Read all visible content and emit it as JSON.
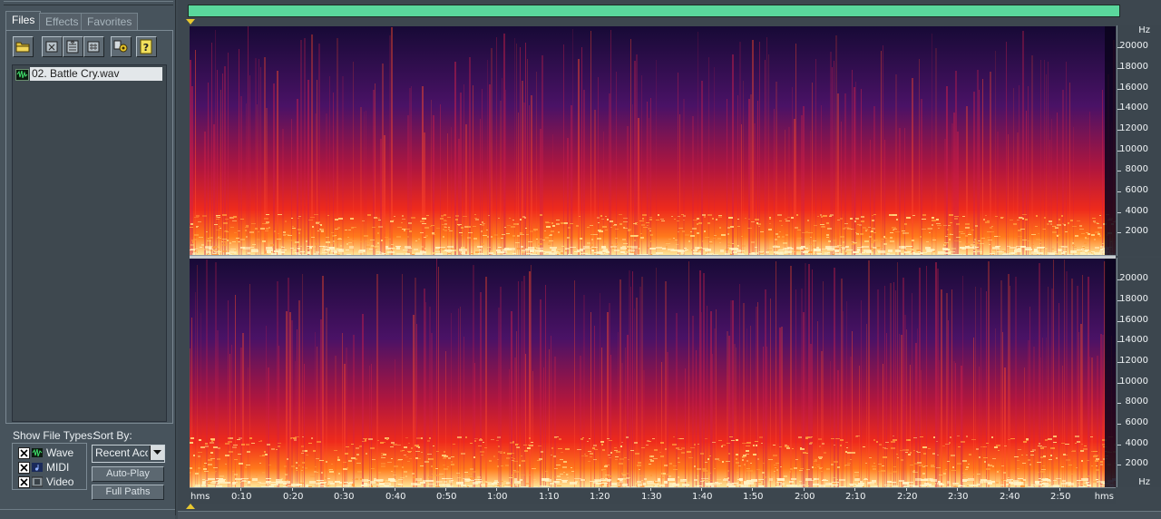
{
  "organizer": {
    "tabs": [
      {
        "label": "Files",
        "active": true
      },
      {
        "label": "Effects",
        "active": false
      },
      {
        "label": "Favorites",
        "active": false
      }
    ],
    "toolbar_icons": [
      "open-folder-icon",
      "close-file-icon",
      "close-all-icon",
      "insert-into-multitrack-icon",
      "options-icon",
      "help-icon"
    ],
    "files": [
      {
        "name": "02. Battle Cry.wav",
        "icon": "wave-file-icon",
        "selected": true
      }
    ],
    "show_file_types_label": "Show File Types:",
    "sort_by_label": "Sort By:",
    "file_types": [
      {
        "label": "Wave",
        "checked": true,
        "icon": "wave-icon"
      },
      {
        "label": "MIDI",
        "checked": true,
        "icon": "midi-icon"
      },
      {
        "label": "Video",
        "checked": true,
        "icon": "video-icon"
      }
    ],
    "sort_value": "Recent Access",
    "buttons": {
      "auto_play": "Auto-Play",
      "full_paths": "Full Paths"
    }
  },
  "spectral": {
    "hz_unit": "Hz",
    "hz_ticks": [
      "20000",
      "18000",
      "16000",
      "14000",
      "12000",
      "10000",
      "8000",
      "6000",
      "4000",
      "2000"
    ],
    "hz_values": [
      20000,
      18000,
      16000,
      14000,
      12000,
      10000,
      8000,
      6000,
      4000,
      2000
    ],
    "hz_max": 22050,
    "time_unit": "hms",
    "time_ticks": [
      "0:10",
      "0:20",
      "0:30",
      "0:40",
      "0:50",
      "1:00",
      "1:10",
      "1:20",
      "1:30",
      "1:40",
      "1:50",
      "2:00",
      "2:10",
      "2:20",
      "2:30",
      "2:40",
      "2:50"
    ],
    "time_seconds": [
      10,
      20,
      30,
      40,
      50,
      60,
      70,
      80,
      90,
      100,
      110,
      120,
      130,
      140,
      150,
      160,
      170
    ],
    "duration_seconds": 181,
    "colors": {
      "overview": "#5ad79c",
      "low": "#0b041c",
      "mid": "#e8122a",
      "high": "#fff0b0",
      "cursor": "#e8c830"
    }
  }
}
